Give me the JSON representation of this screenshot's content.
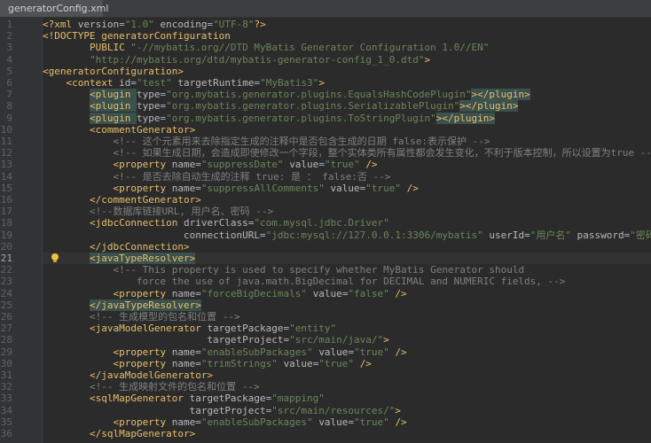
{
  "tab": {
    "file_name": "generatorConfig.xml",
    "icon": "xml-file-icon"
  },
  "colors": {
    "tag": "#e8bf6a",
    "attr": "#bababa",
    "value": "#6a8759",
    "comment": "#808080",
    "bg": "#2b2b2b"
  },
  "current_line": 21,
  "lines": [
    {
      "n": "1",
      "indent": 0,
      "segs": [
        [
          "decl",
          "<?xml "
        ],
        [
          "attr",
          "version"
        ],
        [
          "plain",
          "="
        ],
        [
          "val",
          "\"1.0\""
        ],
        [
          "plain",
          " "
        ],
        [
          "attr",
          "encoding"
        ],
        [
          "plain",
          "="
        ],
        [
          "val",
          "\"UTF-8\""
        ],
        [
          "decl",
          "?>"
        ]
      ]
    },
    {
      "n": "2",
      "indent": 0,
      "segs": [
        [
          "decl",
          "<!DOCTYPE generatorConfiguration"
        ]
      ]
    },
    {
      "n": "3",
      "indent": 8,
      "segs": [
        [
          "decl",
          "PUBLIC "
        ],
        [
          "val",
          "\"-//mybatis.org//DTD MyBatis Generator Configuration 1.0//EN\""
        ]
      ]
    },
    {
      "n": "4",
      "indent": 8,
      "segs": [
        [
          "val",
          "\"http://mybatis.org/dtd/mybatis-generator-config_1_0.dtd\""
        ],
        [
          "decl",
          ">"
        ]
      ]
    },
    {
      "n": "5",
      "indent": 0,
      "segs": [
        [
          "tag",
          "<generatorConfiguration>"
        ]
      ]
    },
    {
      "n": "6",
      "indent": 4,
      "segs": [
        [
          "tag",
          "<context "
        ],
        [
          "attr",
          "id"
        ],
        [
          "plain",
          "="
        ],
        [
          "val",
          "\"test\""
        ],
        [
          "plain",
          " "
        ],
        [
          "attr",
          "targetRuntime"
        ],
        [
          "plain",
          "="
        ],
        [
          "val",
          "\"MyBatis3\""
        ],
        [
          "tag",
          ">"
        ]
      ]
    },
    {
      "n": "7",
      "indent": 8,
      "segs": [
        [
          "taghl",
          "<plugin "
        ],
        [
          "attr",
          "type"
        ],
        [
          "plain",
          "="
        ],
        [
          "val",
          "\"org.mybatis.generator.plugins.EqualsHashCodePlugin\""
        ],
        [
          "taghl",
          "></plugin>"
        ]
      ]
    },
    {
      "n": "8",
      "indent": 8,
      "segs": [
        [
          "taghl",
          "<plugin "
        ],
        [
          "attr",
          "type"
        ],
        [
          "plain",
          "="
        ],
        [
          "val",
          "\"org.mybatis.generator.plugins.SerializablePlugin\""
        ],
        [
          "taghl",
          "></plugin>"
        ]
      ]
    },
    {
      "n": "9",
      "indent": 8,
      "segs": [
        [
          "taghl",
          "<plugin "
        ],
        [
          "attr",
          "type"
        ],
        [
          "plain",
          "="
        ],
        [
          "val",
          "\"org.mybatis.generator.plugins.ToStringPlugin\""
        ],
        [
          "taghl",
          "></plugin>"
        ]
      ]
    },
    {
      "n": "10",
      "indent": 8,
      "segs": [
        [
          "tag",
          "<commentGenerator>"
        ]
      ]
    },
    {
      "n": "11",
      "indent": 12,
      "segs": [
        [
          "cmt",
          "<!-- 这个元素用来去除指定生成的注释中是否包含生成的日期 false:表示保护 -->"
        ]
      ]
    },
    {
      "n": "12",
      "indent": 12,
      "segs": [
        [
          "cmt",
          "<!-- 如果生成日期，会造成即使修改一个字段，整个实体类所有属性都会发生变化，不利于版本控制，所以设置为true -->"
        ]
      ]
    },
    {
      "n": "13",
      "indent": 12,
      "segs": [
        [
          "tag",
          "<property "
        ],
        [
          "attr",
          "name"
        ],
        [
          "plain",
          "="
        ],
        [
          "val",
          "\"suppressDate\""
        ],
        [
          "plain",
          " "
        ],
        [
          "attr",
          "value"
        ],
        [
          "plain",
          "="
        ],
        [
          "val",
          "\"true\""
        ],
        [
          "plain",
          " "
        ],
        [
          "tag",
          "/>"
        ]
      ]
    },
    {
      "n": "14",
      "indent": 12,
      "segs": [
        [
          "cmt",
          "<!-- 是否去除自动生成的注释 true: 是 ： false:否 -->"
        ]
      ]
    },
    {
      "n": "15",
      "indent": 12,
      "segs": [
        [
          "tag",
          "<property "
        ],
        [
          "attr",
          "name"
        ],
        [
          "plain",
          "="
        ],
        [
          "val",
          "\"suppressAllComments\""
        ],
        [
          "plain",
          " "
        ],
        [
          "attr",
          "value"
        ],
        [
          "plain",
          "="
        ],
        [
          "val",
          "\"true\""
        ],
        [
          "plain",
          " "
        ],
        [
          "tag",
          "/>"
        ]
      ]
    },
    {
      "n": "16",
      "indent": 8,
      "segs": [
        [
          "tag",
          "</commentGenerator>"
        ]
      ]
    },
    {
      "n": "17",
      "indent": 8,
      "segs": [
        [
          "cmt",
          "<!--数据库链接URL, 用户名、密码 -->"
        ]
      ]
    },
    {
      "n": "18",
      "indent": 8,
      "segs": [
        [
          "tag",
          "<jdbcConnection "
        ],
        [
          "attr",
          "driverClass"
        ],
        [
          "plain",
          "="
        ],
        [
          "val",
          "\"com.mysql.jdbc.Driver\""
        ]
      ]
    },
    {
      "n": "19",
      "indent": 24,
      "segs": [
        [
          "attr",
          "connectionURL"
        ],
        [
          "plain",
          "="
        ],
        [
          "val",
          "\"jdbc:mysql://127.0.0.1:3306/mybatis\""
        ],
        [
          "plain",
          " "
        ],
        [
          "attr",
          "userId"
        ],
        [
          "plain",
          "="
        ],
        [
          "val",
          "\"用户名\""
        ],
        [
          "plain",
          " "
        ],
        [
          "attr",
          "password"
        ],
        [
          "plain",
          "="
        ],
        [
          "val",
          "\"密码\""
        ],
        [
          "tag",
          ">"
        ]
      ]
    },
    {
      "n": "20",
      "indent": 8,
      "segs": [
        [
          "tag",
          "</jdbcConnection>"
        ]
      ]
    },
    {
      "n": "21",
      "indent": 8,
      "segs": [
        [
          "taghl",
          "<javaTypeResolver>"
        ]
      ]
    },
    {
      "n": "22",
      "indent": 12,
      "segs": [
        [
          "cmt",
          "<!-- This property is used to specify whether MyBatis Generator should"
        ]
      ]
    },
    {
      "n": "23",
      "indent": 16,
      "segs": [
        [
          "cmt",
          "force the use of java.math.BigDecimal for DECIMAL and NUMERIC fields, -->"
        ]
      ]
    },
    {
      "n": "24",
      "indent": 12,
      "segs": [
        [
          "tag",
          "<property "
        ],
        [
          "attr",
          "name"
        ],
        [
          "plain",
          "="
        ],
        [
          "val",
          "\"forceBigDecimals\""
        ],
        [
          "plain",
          " "
        ],
        [
          "attr",
          "value"
        ],
        [
          "plain",
          "="
        ],
        [
          "val",
          "\"false\""
        ],
        [
          "plain",
          " "
        ],
        [
          "tag",
          "/>"
        ]
      ]
    },
    {
      "n": "25",
      "indent": 8,
      "segs": [
        [
          "taghl",
          "</javaTypeResolver>"
        ]
      ]
    },
    {
      "n": "26",
      "indent": 8,
      "segs": [
        [
          "cmt",
          "<!-- 生成模型的包名和位置 -->"
        ]
      ]
    },
    {
      "n": "27",
      "indent": 8,
      "segs": [
        [
          "tag",
          "<javaModelGenerator "
        ],
        [
          "attr",
          "targetPackage"
        ],
        [
          "plain",
          "="
        ],
        [
          "val",
          "\"entity\""
        ]
      ]
    },
    {
      "n": "28",
      "indent": 28,
      "segs": [
        [
          "attr",
          "targetProject"
        ],
        [
          "plain",
          "="
        ],
        [
          "val",
          "\"src/main/java/\""
        ],
        [
          "tag",
          ">"
        ]
      ]
    },
    {
      "n": "29",
      "indent": 12,
      "segs": [
        [
          "tag",
          "<property "
        ],
        [
          "attr",
          "name"
        ],
        [
          "plain",
          "="
        ],
        [
          "val",
          "\"enableSubPackages\""
        ],
        [
          "plain",
          " "
        ],
        [
          "attr",
          "value"
        ],
        [
          "plain",
          "="
        ],
        [
          "val",
          "\"true\""
        ],
        [
          "plain",
          " "
        ],
        [
          "tag",
          "/>"
        ]
      ]
    },
    {
      "n": "30",
      "indent": 12,
      "segs": [
        [
          "tag",
          "<property "
        ],
        [
          "attr",
          "name"
        ],
        [
          "plain",
          "="
        ],
        [
          "val",
          "\"trimStrings\""
        ],
        [
          "plain",
          " "
        ],
        [
          "attr",
          "value"
        ],
        [
          "plain",
          "="
        ],
        [
          "val",
          "\"true\""
        ],
        [
          "plain",
          " "
        ],
        [
          "tag",
          "/>"
        ]
      ]
    },
    {
      "n": "31",
      "indent": 8,
      "segs": [
        [
          "tag",
          "</javaModelGenerator>"
        ]
      ]
    },
    {
      "n": "32",
      "indent": 8,
      "segs": [
        [
          "cmt",
          "<!-- 生成映射文件的包名和位置 -->"
        ]
      ]
    },
    {
      "n": "33",
      "indent": 8,
      "segs": [
        [
          "tag",
          "<sqlMapGenerator "
        ],
        [
          "attr",
          "targetPackage"
        ],
        [
          "plain",
          "="
        ],
        [
          "val",
          "\"mapping\""
        ]
      ]
    },
    {
      "n": "34",
      "indent": 25,
      "segs": [
        [
          "attr",
          "targetProject"
        ],
        [
          "plain",
          "="
        ],
        [
          "val",
          "\"src/main/resources/\""
        ],
        [
          "tag",
          ">"
        ]
      ]
    },
    {
      "n": "35",
      "indent": 12,
      "segs": [
        [
          "tag",
          "<property "
        ],
        [
          "attr",
          "name"
        ],
        [
          "plain",
          "="
        ],
        [
          "val",
          "\"enableSubPackages\""
        ],
        [
          "plain",
          " "
        ],
        [
          "attr",
          "value"
        ],
        [
          "plain",
          "="
        ],
        [
          "val",
          "\"true\""
        ],
        [
          "plain",
          " "
        ],
        [
          "tag",
          "/>"
        ]
      ]
    },
    {
      "n": "36",
      "indent": 8,
      "segs": [
        [
          "tag",
          "</sqlMapGenerator>"
        ]
      ]
    }
  ]
}
